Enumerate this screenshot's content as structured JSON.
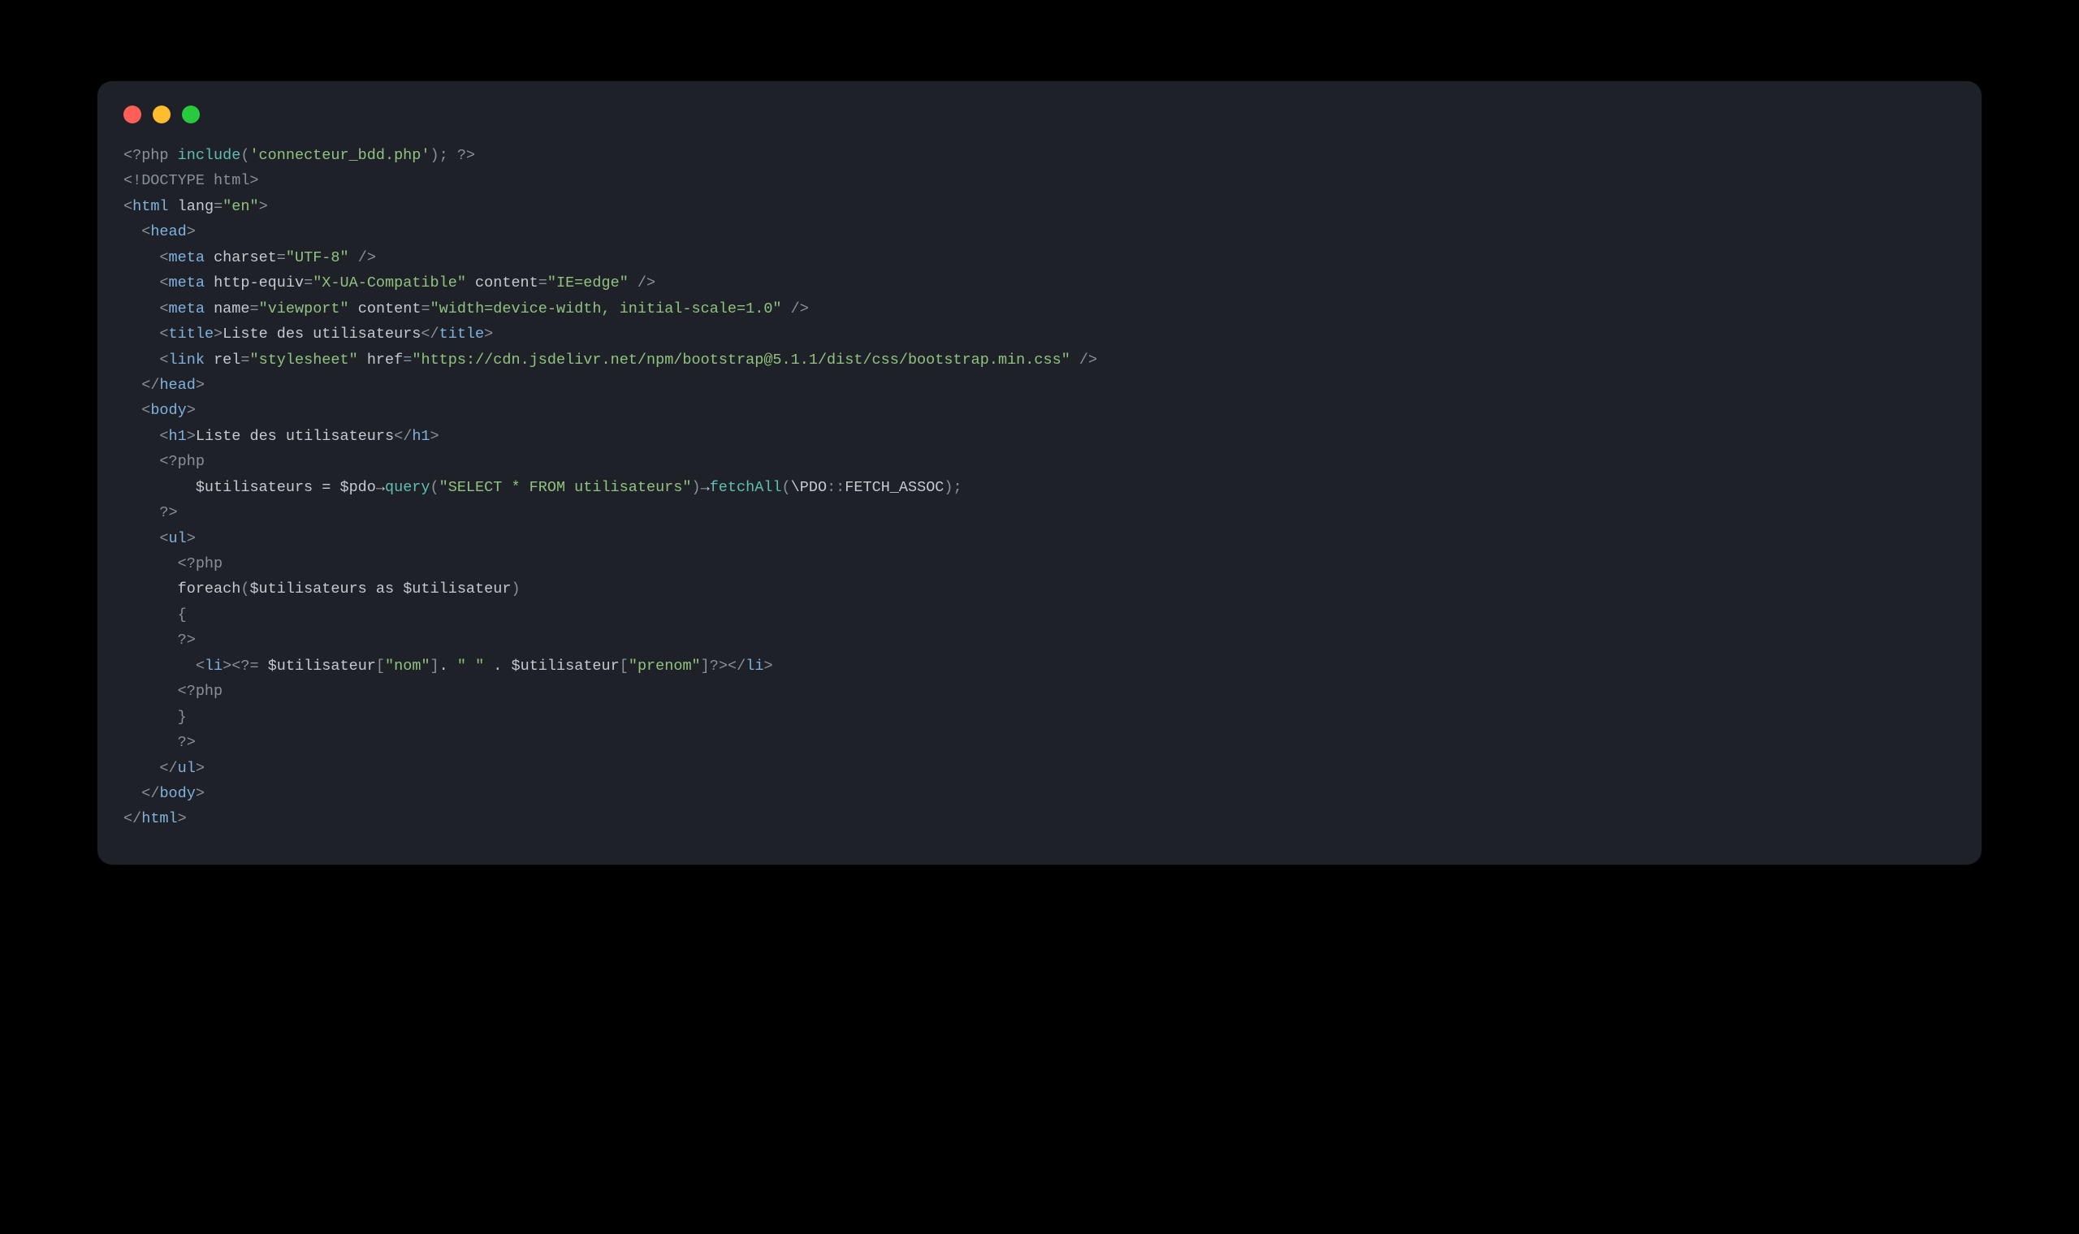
{
  "window": {
    "dots": [
      "close",
      "minimize",
      "zoom"
    ]
  },
  "code": {
    "lines": [
      [
        {
          "t": "<?php",
          "c": "c-punct"
        },
        {
          "t": " ",
          "c": "c-default"
        },
        {
          "t": "include",
          "c": "c-func"
        },
        {
          "t": "(",
          "c": "c-punct"
        },
        {
          "t": "'connecteur_bdd.php'",
          "c": "c-str"
        },
        {
          "t": "); ",
          "c": "c-punct"
        },
        {
          "t": "?>",
          "c": "c-punct"
        }
      ],
      [
        {
          "t": "<!DOCTYPE html>",
          "c": "c-punct"
        }
      ],
      [
        {
          "t": "<",
          "c": "c-punct"
        },
        {
          "t": "html",
          "c": "c-tag"
        },
        {
          "t": " ",
          "c": "c-default"
        },
        {
          "t": "lang",
          "c": "c-attr"
        },
        {
          "t": "=",
          "c": "c-punct"
        },
        {
          "t": "\"en\"",
          "c": "c-str"
        },
        {
          "t": ">",
          "c": "c-punct"
        }
      ],
      [
        {
          "t": "  ",
          "c": "c-default"
        },
        {
          "t": "<",
          "c": "c-punct"
        },
        {
          "t": "head",
          "c": "c-tag"
        },
        {
          "t": ">",
          "c": "c-punct"
        }
      ],
      [
        {
          "t": "    ",
          "c": "c-default"
        },
        {
          "t": "<",
          "c": "c-punct"
        },
        {
          "t": "meta",
          "c": "c-tag"
        },
        {
          "t": " ",
          "c": "c-default"
        },
        {
          "t": "charset",
          "c": "c-attr"
        },
        {
          "t": "=",
          "c": "c-punct"
        },
        {
          "t": "\"UTF-8\"",
          "c": "c-str"
        },
        {
          "t": " />",
          "c": "c-punct"
        }
      ],
      [
        {
          "t": "    ",
          "c": "c-default"
        },
        {
          "t": "<",
          "c": "c-punct"
        },
        {
          "t": "meta",
          "c": "c-tag"
        },
        {
          "t": " ",
          "c": "c-default"
        },
        {
          "t": "http-equiv",
          "c": "c-attr"
        },
        {
          "t": "=",
          "c": "c-punct"
        },
        {
          "t": "\"X-UA-Compatible\"",
          "c": "c-str"
        },
        {
          "t": " ",
          "c": "c-default"
        },
        {
          "t": "content",
          "c": "c-attr"
        },
        {
          "t": "=",
          "c": "c-punct"
        },
        {
          "t": "\"IE=edge\"",
          "c": "c-str"
        },
        {
          "t": " />",
          "c": "c-punct"
        }
      ],
      [
        {
          "t": "    ",
          "c": "c-default"
        },
        {
          "t": "<",
          "c": "c-punct"
        },
        {
          "t": "meta",
          "c": "c-tag"
        },
        {
          "t": " ",
          "c": "c-default"
        },
        {
          "t": "name",
          "c": "c-attr"
        },
        {
          "t": "=",
          "c": "c-punct"
        },
        {
          "t": "\"viewport\"",
          "c": "c-str"
        },
        {
          "t": " ",
          "c": "c-default"
        },
        {
          "t": "content",
          "c": "c-attr"
        },
        {
          "t": "=",
          "c": "c-punct"
        },
        {
          "t": "\"width=device-width, initial-scale=1.0\"",
          "c": "c-str"
        },
        {
          "t": " />",
          "c": "c-punct"
        }
      ],
      [
        {
          "t": "    ",
          "c": "c-default"
        },
        {
          "t": "<",
          "c": "c-punct"
        },
        {
          "t": "title",
          "c": "c-tag"
        },
        {
          "t": ">",
          "c": "c-punct"
        },
        {
          "t": "Liste des utilisateurs",
          "c": "c-default"
        },
        {
          "t": "</",
          "c": "c-punct"
        },
        {
          "t": "title",
          "c": "c-tag"
        },
        {
          "t": ">",
          "c": "c-punct"
        }
      ],
      [
        {
          "t": "    ",
          "c": "c-default"
        },
        {
          "t": "<",
          "c": "c-punct"
        },
        {
          "t": "link",
          "c": "c-tag"
        },
        {
          "t": " ",
          "c": "c-default"
        },
        {
          "t": "rel",
          "c": "c-attr"
        },
        {
          "t": "=",
          "c": "c-punct"
        },
        {
          "t": "\"stylesheet\"",
          "c": "c-str"
        },
        {
          "t": " ",
          "c": "c-default"
        },
        {
          "t": "href",
          "c": "c-attr"
        },
        {
          "t": "=",
          "c": "c-punct"
        },
        {
          "t": "\"https://cdn.jsdelivr.net/npm/bootstrap@5.1.1/dist/css/bootstrap.min.css\"",
          "c": "c-str"
        },
        {
          "t": " />",
          "c": "c-punct"
        }
      ],
      [
        {
          "t": "  ",
          "c": "c-default"
        },
        {
          "t": "</",
          "c": "c-punct"
        },
        {
          "t": "head",
          "c": "c-tag"
        },
        {
          "t": ">",
          "c": "c-punct"
        }
      ],
      [
        {
          "t": "  ",
          "c": "c-default"
        },
        {
          "t": "<",
          "c": "c-punct"
        },
        {
          "t": "body",
          "c": "c-tag"
        },
        {
          "t": ">",
          "c": "c-punct"
        }
      ],
      [
        {
          "t": "    ",
          "c": "c-default"
        },
        {
          "t": "<",
          "c": "c-punct"
        },
        {
          "t": "h1",
          "c": "c-tag"
        },
        {
          "t": ">",
          "c": "c-punct"
        },
        {
          "t": "Liste des utilisateurs",
          "c": "c-default"
        },
        {
          "t": "</",
          "c": "c-punct"
        },
        {
          "t": "h1",
          "c": "c-tag"
        },
        {
          "t": ">",
          "c": "c-punct"
        }
      ],
      [
        {
          "t": "    ",
          "c": "c-default"
        },
        {
          "t": "<?php",
          "c": "c-punct"
        }
      ],
      [
        {
          "t": "        ",
          "c": "c-default"
        },
        {
          "t": "$utilisateurs",
          "c": "c-var"
        },
        {
          "t": " = ",
          "c": "c-op"
        },
        {
          "t": "$pdo",
          "c": "c-var"
        },
        {
          "t": "→",
          "c": "c-op"
        },
        {
          "t": "query",
          "c": "c-func"
        },
        {
          "t": "(",
          "c": "c-punct"
        },
        {
          "t": "\"SELECT * FROM utilisateurs\"",
          "c": "c-str"
        },
        {
          "t": ")",
          "c": "c-punct"
        },
        {
          "t": "→",
          "c": "c-op"
        },
        {
          "t": "fetchAll",
          "c": "c-func"
        },
        {
          "t": "(",
          "c": "c-punct"
        },
        {
          "t": "\\PDO",
          "c": "c-default"
        },
        {
          "t": "::",
          "c": "c-punct"
        },
        {
          "t": "FETCH_ASSOC",
          "c": "c-default"
        },
        {
          "t": ");",
          "c": "c-punct"
        }
      ],
      [
        {
          "t": "    ",
          "c": "c-default"
        },
        {
          "t": "?>",
          "c": "c-punct"
        }
      ],
      [
        {
          "t": "    ",
          "c": "c-default"
        },
        {
          "t": "<",
          "c": "c-punct"
        },
        {
          "t": "ul",
          "c": "c-tag"
        },
        {
          "t": ">",
          "c": "c-punct"
        }
      ],
      [
        {
          "t": "      ",
          "c": "c-default"
        },
        {
          "t": "<?php",
          "c": "c-punct"
        }
      ],
      [
        {
          "t": "      ",
          "c": "c-default"
        },
        {
          "t": "foreach",
          "c": "c-kw"
        },
        {
          "t": "(",
          "c": "c-punct"
        },
        {
          "t": "$utilisateurs",
          "c": "c-var"
        },
        {
          "t": " as ",
          "c": "c-kw"
        },
        {
          "t": "$utilisateur",
          "c": "c-var"
        },
        {
          "t": ")",
          "c": "c-punct"
        }
      ],
      [
        {
          "t": "      ",
          "c": "c-default"
        },
        {
          "t": "{",
          "c": "c-punct"
        }
      ],
      [
        {
          "t": "      ",
          "c": "c-default"
        },
        {
          "t": "?>",
          "c": "c-punct"
        }
      ],
      [
        {
          "t": "        ",
          "c": "c-default"
        },
        {
          "t": "<",
          "c": "c-punct"
        },
        {
          "t": "li",
          "c": "c-tag"
        },
        {
          "t": ">",
          "c": "c-punct"
        },
        {
          "t": "<?=",
          "c": "c-punct"
        },
        {
          "t": " ",
          "c": "c-default"
        },
        {
          "t": "$utilisateur",
          "c": "c-var"
        },
        {
          "t": "[",
          "c": "c-punct"
        },
        {
          "t": "\"nom\"",
          "c": "c-str"
        },
        {
          "t": "]",
          "c": "c-punct"
        },
        {
          "t": ". ",
          "c": "c-op"
        },
        {
          "t": "\" \"",
          "c": "c-str"
        },
        {
          "t": " . ",
          "c": "c-op"
        },
        {
          "t": "$utilisateur",
          "c": "c-var"
        },
        {
          "t": "[",
          "c": "c-punct"
        },
        {
          "t": "\"prenom\"",
          "c": "c-str"
        },
        {
          "t": "]",
          "c": "c-punct"
        },
        {
          "t": "?>",
          "c": "c-punct"
        },
        {
          "t": "</",
          "c": "c-punct"
        },
        {
          "t": "li",
          "c": "c-tag"
        },
        {
          "t": ">",
          "c": "c-punct"
        }
      ],
      [
        {
          "t": "      ",
          "c": "c-default"
        },
        {
          "t": "<?php",
          "c": "c-punct"
        }
      ],
      [
        {
          "t": "      ",
          "c": "c-default"
        },
        {
          "t": "}",
          "c": "c-punct"
        }
      ],
      [
        {
          "t": "      ",
          "c": "c-default"
        },
        {
          "t": "?>",
          "c": "c-punct"
        }
      ],
      [
        {
          "t": "    ",
          "c": "c-default"
        },
        {
          "t": "</",
          "c": "c-punct"
        },
        {
          "t": "ul",
          "c": "c-tag"
        },
        {
          "t": ">",
          "c": "c-punct"
        }
      ],
      [
        {
          "t": "  ",
          "c": "c-default"
        },
        {
          "t": "</",
          "c": "c-punct"
        },
        {
          "t": "body",
          "c": "c-tag"
        },
        {
          "t": ">",
          "c": "c-punct"
        }
      ],
      [
        {
          "t": "</",
          "c": "c-punct"
        },
        {
          "t": "html",
          "c": "c-tag"
        },
        {
          "t": ">",
          "c": "c-punct"
        }
      ]
    ]
  }
}
